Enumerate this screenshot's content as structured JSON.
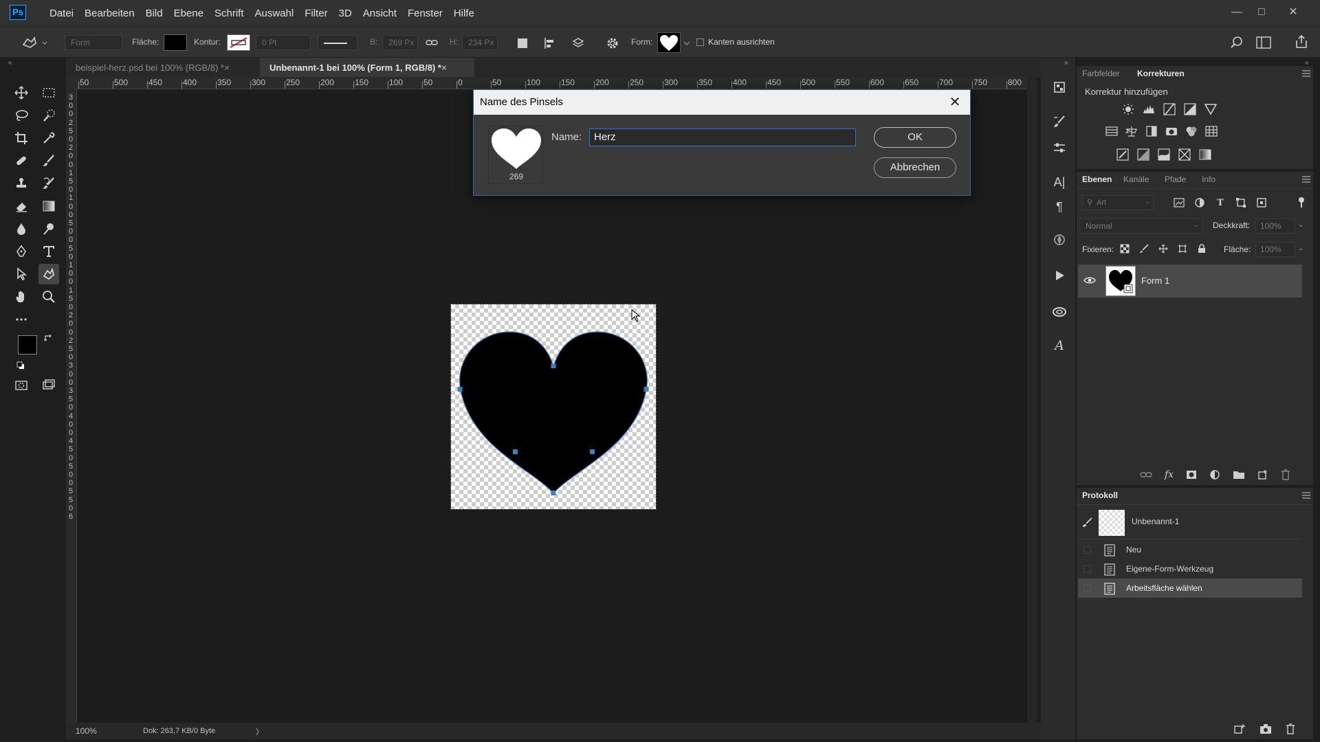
{
  "app": {
    "logo": "Ps"
  },
  "menu": [
    "Datei",
    "Bearbeiten",
    "Bild",
    "Ebene",
    "Schrift",
    "Auswahl",
    "Filter",
    "3D",
    "Ansicht",
    "Fenster",
    "Hilfe"
  ],
  "options": {
    "mode": "Form",
    "fill_label": "Fläche:",
    "stroke_label": "Kontur:",
    "stroke_width": "0 Pt",
    "w_label": "B:",
    "w_value": "269 Px",
    "h_label": "H:",
    "h_value": "234 Px",
    "shape_label": "Form:",
    "align_edges": "Kanten ausrichten"
  },
  "tabs": [
    {
      "label": "beispiel-herz.psd bei 100% (RGB/8) *",
      "close": "×"
    },
    {
      "label": "Unbenannt-1 bei 100% (Form 1, RGB/8) *",
      "close": "×"
    }
  ],
  "ruler_h": [
    "50",
    "500",
    "450",
    "400",
    "350",
    "300",
    "250",
    "200",
    "150",
    "100",
    "50",
    "0",
    "50",
    "100",
    "150",
    "200",
    "250",
    "300",
    "350",
    "400",
    "450",
    "500",
    "550",
    "600",
    "650",
    "700",
    "750",
    "800"
  ],
  "ruler_v": [
    "3",
    "0",
    "0",
    "2",
    "5",
    "0",
    "2",
    "0",
    "0",
    "1",
    "5",
    "0",
    "1",
    "0",
    "0",
    "5",
    "0",
    "0",
    "5",
    "0",
    "1",
    "0",
    "0",
    "1",
    "5",
    "0",
    "2",
    "0",
    "0",
    "2",
    "5",
    "0",
    "3",
    "0",
    "0",
    "3",
    "5",
    "0",
    "4",
    "0",
    "0",
    "4",
    "5",
    "0",
    "5",
    "0",
    "0",
    "5",
    "5",
    "0",
    "6"
  ],
  "dialog": {
    "title": "Name des Pinsels",
    "brush_size": "269",
    "name_label": "Name:",
    "name_value": "Herz",
    "ok": "OK",
    "cancel": "Abbrechen"
  },
  "right": {
    "tabs_top": [
      "Farbfelder",
      "Korrekturen"
    ],
    "add_adjustment": "Korrektur hinzufügen",
    "layers_tabs": [
      "Ebenen",
      "Kanäle",
      "Pfade",
      "Info"
    ],
    "filter_placeholder": "Art",
    "blend_mode": "Normal",
    "opacity_label": "Deckkraft:",
    "opacity_value": "100%",
    "lock_label": "Fixieren:",
    "fill_label": "Fläche:",
    "fill_value": "100%",
    "layer_name": "Form 1",
    "history_title": "Protokoll",
    "history_snapshot": "Unbenannt-1",
    "history_items": [
      "Neu",
      "Eigene-Form-Werkzeug",
      "Arbeitsfläche wählen"
    ]
  },
  "status": {
    "zoom": "100%",
    "doc": "Dok: 263,7 KB/0 Byte",
    "arrow": "〉"
  }
}
